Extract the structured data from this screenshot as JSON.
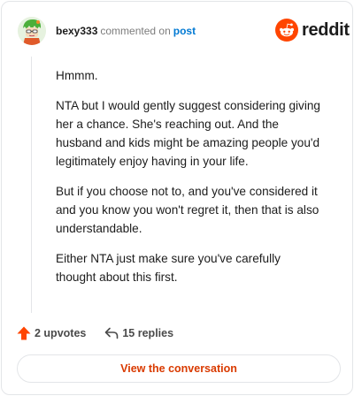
{
  "header": {
    "username": "bexy333",
    "action_text": "commented on",
    "post_link": "post",
    "brand": "reddit"
  },
  "comment": {
    "paragraphs": [
      "Hmmm.",
      "NTA but I would gently suggest considering giving her a chance. She's reaching out. And the husband and kids might be amazing people you'd legitimately enjoy having in your life.",
      "But if you choose not to, and you've considered it and you know you won't regret it, then that is also understandable.",
      "Either NTA just make sure you've carefully thought about this first."
    ]
  },
  "footer": {
    "upvotes": "2 upvotes",
    "replies": "15 replies"
  },
  "cta": {
    "label": "View the conversation"
  },
  "colors": {
    "brand": "#ff4500",
    "cta_text": "#d93a00",
    "link": "#0079d3"
  },
  "icons": {
    "avatar": "avatar",
    "logo": "reddit-snoo-icon",
    "upvote": "upvote-arrow-icon",
    "reply": "reply-arrow-icon"
  }
}
